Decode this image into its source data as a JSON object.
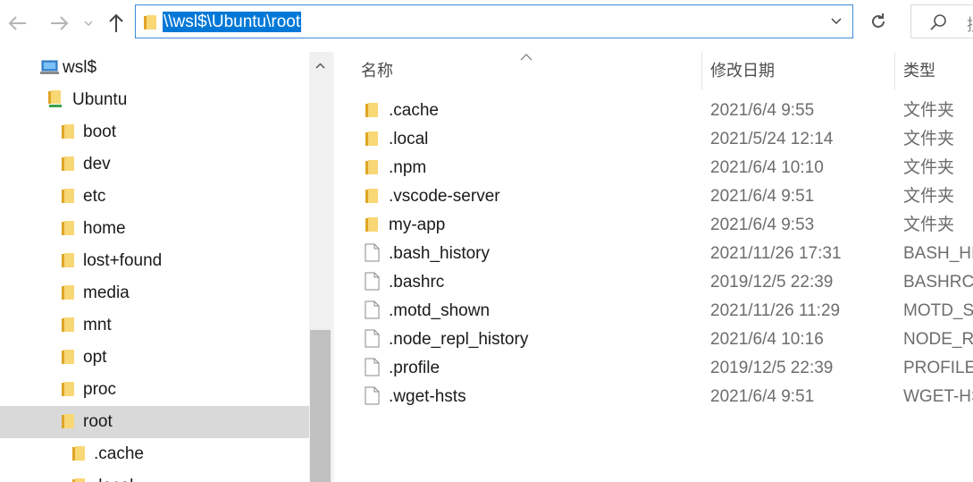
{
  "address_bar": {
    "path": "\\\\wsl$\\Ubuntu\\root"
  },
  "search": {
    "partial_text": "搜"
  },
  "nav_tree": {
    "items": [
      {
        "label": "wsl$",
        "icon": "network-computer-icon",
        "indent": 0
      },
      {
        "label": "Ubuntu",
        "icon": "network-folder-icon",
        "indent": 1
      },
      {
        "label": "boot",
        "icon": "folder-icon",
        "indent": 2
      },
      {
        "label": "dev",
        "icon": "folder-icon",
        "indent": 2
      },
      {
        "label": "etc",
        "icon": "folder-icon",
        "indent": 2
      },
      {
        "label": "home",
        "icon": "folder-icon",
        "indent": 2
      },
      {
        "label": "lost+found",
        "icon": "folder-icon",
        "indent": 2
      },
      {
        "label": "media",
        "icon": "folder-icon",
        "indent": 2
      },
      {
        "label": "mnt",
        "icon": "folder-icon",
        "indent": 2
      },
      {
        "label": "opt",
        "icon": "folder-icon",
        "indent": 2
      },
      {
        "label": "proc",
        "icon": "folder-icon",
        "indent": 2
      },
      {
        "label": "root",
        "icon": "folder-icon",
        "indent": 2,
        "selected": true
      },
      {
        "label": ".cache",
        "icon": "folder-icon",
        "indent": 3
      },
      {
        "label": ".local",
        "icon": "folder-icon",
        "indent": 3
      }
    ]
  },
  "file_list": {
    "columns": {
      "name": "名称",
      "date": "修改日期",
      "type": "类型"
    },
    "rows": [
      {
        "name": ".cache",
        "date": "2021/6/4 9:55",
        "type": "文件夹",
        "kind": "folder"
      },
      {
        "name": ".local",
        "date": "2021/5/24 12:14",
        "type": "文件夹",
        "kind": "folder"
      },
      {
        "name": ".npm",
        "date": "2021/6/4 10:10",
        "type": "文件夹",
        "kind": "folder"
      },
      {
        "name": ".vscode-server",
        "date": "2021/6/4 9:51",
        "type": "文件夹",
        "kind": "folder"
      },
      {
        "name": "my-app",
        "date": "2021/6/4 9:53",
        "type": "文件夹",
        "kind": "folder"
      },
      {
        "name": ".bash_history",
        "date": "2021/11/26 17:31",
        "type": "BASH_HISTORY 文件",
        "kind": "file"
      },
      {
        "name": ".bashrc",
        "date": "2019/12/5 22:39",
        "type": "BASHRC 文件",
        "kind": "file"
      },
      {
        "name": ".motd_shown",
        "date": "2021/11/26 11:29",
        "type": "MOTD_SHOWN 文件",
        "kind": "file"
      },
      {
        "name": ".node_repl_history",
        "date": "2021/6/4 10:16",
        "type": "NODE_REPL_HISTORY 文件",
        "kind": "file"
      },
      {
        "name": ".profile",
        "date": "2019/12/5 22:39",
        "type": "PROFILE 文件",
        "kind": "file"
      },
      {
        "name": ".wget-hsts",
        "date": "2021/6/4 9:51",
        "type": "WGET-HSTS 文件",
        "kind": "file"
      }
    ]
  },
  "colors": {
    "accent": "#0078d7",
    "address_border": "#3c8ad8",
    "selected_bg": "#d9d9d9",
    "folder_yellow": "#f8d775",
    "folder_dark": "#e0a526"
  }
}
